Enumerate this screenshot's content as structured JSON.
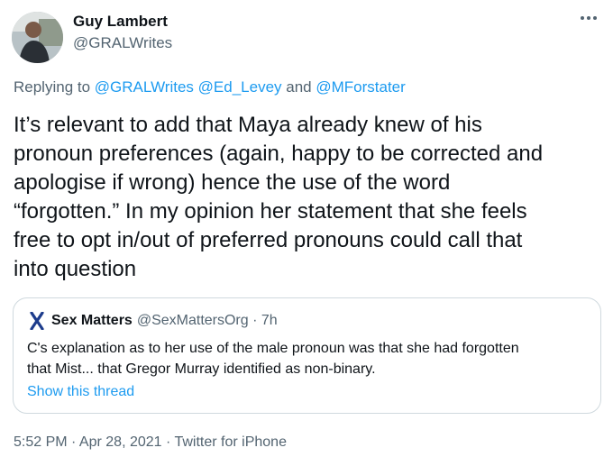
{
  "author": {
    "name": "Guy Lambert",
    "handle": "@GRALWrites"
  },
  "reply": {
    "prefix": "Replying to ",
    "mention1": "@GRALWrites",
    "mention2": "@Ed_Levey",
    "conjunction": " and ",
    "mention3": "@MForstater"
  },
  "tweet": {
    "lines": [
      "It’s relevant to add that Maya already knew of his",
      "pronoun preferences (again, happy to be corrected and",
      "apologise if wrong) hence the use of the word",
      "“forgotten.” In my opinion her statement that she feels",
      "free to opt in/out of preferred pronouns could call that",
      "into question"
    ]
  },
  "quote": {
    "name": "Sex Matters",
    "handle_time": "@SexMattersOrg · 7h",
    "lines": [
      "C's explanation as to her use of the male pronoun was that she had forgotten",
      "that Mist... that Gregor Murray identified as non-binary."
    ],
    "show_thread": "Show this thread",
    "logo_color": "#1d3c8c"
  },
  "timestamp": "5:52 PM · Apr 28, 2021 · Twitter for iPhone",
  "colors": {
    "link": "#1d9bf0",
    "secondary_text": "#536471",
    "border": "#cfd9de"
  }
}
